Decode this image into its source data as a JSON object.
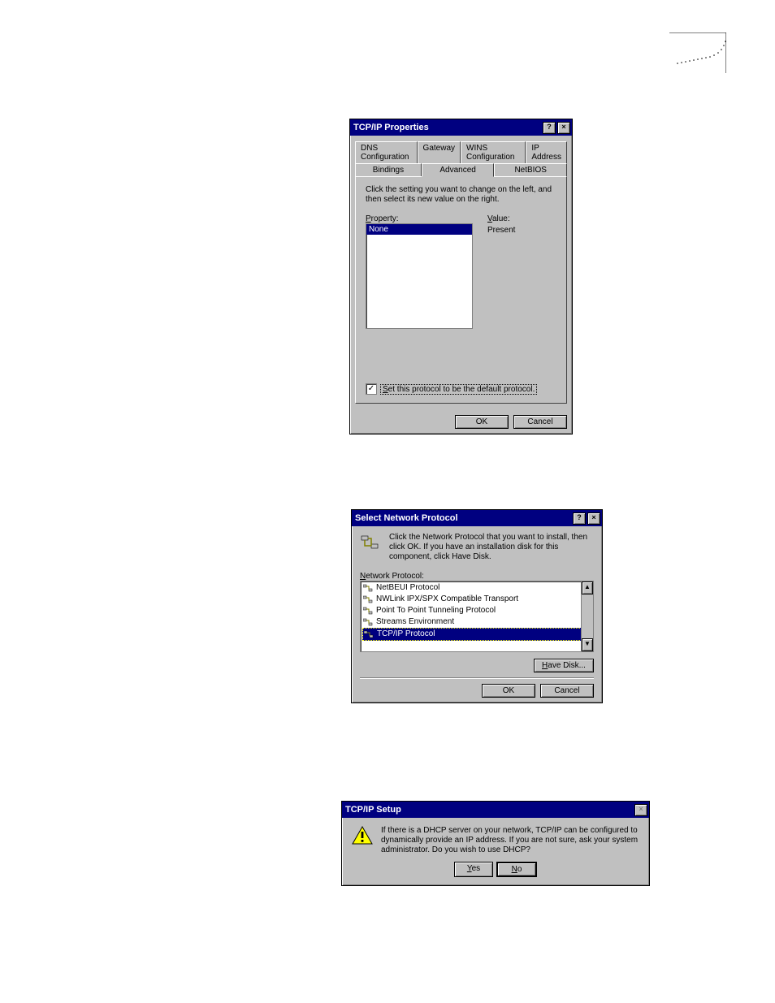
{
  "dialog1": {
    "title": "TCP/IP Properties",
    "tabs_back": [
      "DNS Configuration",
      "Gateway",
      "WINS Configuration",
      "IP Address"
    ],
    "tabs_front": [
      "Bindings",
      "Advanced",
      "NetBIOS"
    ],
    "active_tab": "Advanced",
    "instruction": "Click the setting you want to change on the left, and then select its new value on the right.",
    "property_label": "Property:",
    "value_label": "Value:",
    "property_items": [
      "None"
    ],
    "value_text": "Present",
    "checkbox_label": "Set this protocol to be the default protocol.",
    "checkbox_checked": true,
    "ok": "OK",
    "cancel": "Cancel"
  },
  "dialog2": {
    "title": "Select Network Protocol",
    "instruction": "Click the Network Protocol that you want to install, then click OK.  If you have an installation disk for this component, click Have Disk.",
    "list_label": "Network Protocol:",
    "items": [
      {
        "label": "NetBEUI Protocol",
        "selected": false
      },
      {
        "label": "NWLink IPX/SPX Compatible Transport",
        "selected": false
      },
      {
        "label": "Point To Point Tunneling Protocol",
        "selected": false
      },
      {
        "label": "Streams Environment",
        "selected": false
      },
      {
        "label": "TCP/IP Protocol",
        "selected": true
      }
    ],
    "have_disk": "Have Disk...",
    "ok": "OK",
    "cancel": "Cancel"
  },
  "dialog3": {
    "title": "TCP/IP Setup",
    "message": "If there is a DHCP server on your network, TCP/IP can be configured to dynamically provide an IP address.  If you are not sure, ask your system administrator.  Do you wish to use DHCP?",
    "yes": "Yes",
    "no": "No"
  }
}
